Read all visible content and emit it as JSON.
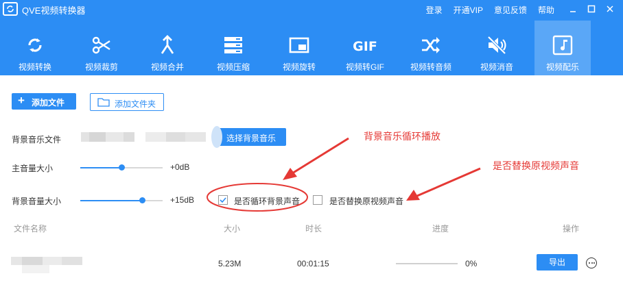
{
  "app": {
    "title": "QVE视频转换器",
    "links": [
      "登录",
      "开通VIP",
      "意见反馈",
      "帮助"
    ]
  },
  "toolbar": {
    "items": [
      {
        "label": "视频转换",
        "icon": "refresh-icon"
      },
      {
        "label": "视频裁剪",
        "icon": "scissors-icon"
      },
      {
        "label": "视频合并",
        "icon": "merge-icon"
      },
      {
        "label": "视频压缩",
        "icon": "compress-icon"
      },
      {
        "label": "视频旋转",
        "icon": "rotate-icon"
      },
      {
        "label": "视频转GIF",
        "icon": "gif-icon"
      },
      {
        "label": "视频转音频",
        "icon": "shuffle-icon"
      },
      {
        "label": "视频消音",
        "icon": "mute-icon"
      },
      {
        "label": "视频配乐",
        "icon": "music-note-icon"
      }
    ],
    "active_index": 8,
    "gif_glyph": "GIF"
  },
  "actions": {
    "add_file": "添加文件",
    "add_folder": "添加文件夹"
  },
  "settings": {
    "bgm_label": "背景音乐文件",
    "select_bgm": "选择背景音乐",
    "main_volume_label": "主音量大小",
    "main_volume_value": "+0dB",
    "main_volume_level": 0.5,
    "bg_volume_label": "背景音量大小",
    "bg_volume_value": "+15dB",
    "bg_volume_level": 0.75,
    "loop_label": "是否循环背景声音",
    "loop_checked": true,
    "replace_label": "是否替换原视频声音",
    "replace_checked": false
  },
  "table": {
    "headers": {
      "name": "文件名称",
      "size": "大小",
      "duration": "时长",
      "progress": "进度",
      "action": "操作"
    },
    "rows": [
      {
        "size": "5.23M",
        "duration": "00:01:15",
        "progress": "0%",
        "export": "导出"
      }
    ]
  },
  "annotations": {
    "loop_note": "背景音乐循环播放",
    "replace_note": "是否替换原视频声音"
  },
  "colors": {
    "accent": "#2c8df4",
    "active_tab": "#5aa7f7",
    "annotation": "#e53935"
  }
}
